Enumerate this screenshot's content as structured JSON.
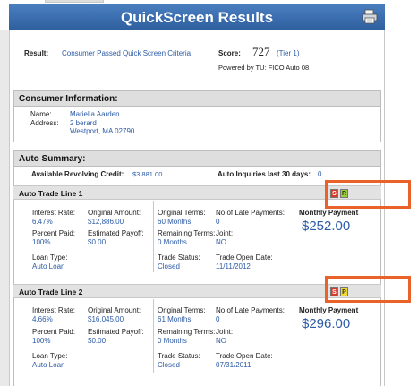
{
  "title": "QuickScreen Results",
  "result": {
    "label": "Result:",
    "value": "Consumer Passed Quick Screen Criteria"
  },
  "score": {
    "label": "Score:",
    "value": "727",
    "tier": "(Tier 1)",
    "powered_by": "Powered by TU: FICO Auto 08"
  },
  "consumer": {
    "header": "Consumer Information:",
    "name_label": "Name:",
    "name": "Mariella Aarden",
    "address_label": "Address:",
    "address_line1": "2 berard",
    "address_line2": "Westport, MA 02790"
  },
  "auto": {
    "header": "Auto Summary:",
    "revolving_label": "Available Revolving Credit:",
    "revolving_value": "$3,881.00",
    "inquiries_label": "Auto Inquiries last 30 days:",
    "inquiries_value": "0"
  },
  "labels": {
    "interest_rate": "Interest Rate:",
    "original_amount": "Original Amount:",
    "original_terms": "Original Terms:",
    "late_payments": "No of Late Payments:",
    "monthly_payment": "Monthly Payment",
    "percent_paid": "Percent Paid:",
    "estimated_payoff": "Estimated Payoff:",
    "remaining_terms": "Remaining Terms:",
    "joint": "Joint:",
    "loan_type": "Loan Type:",
    "trade_status": "Trade Status:",
    "trade_open_date": "Trade Open Date:"
  },
  "trades": [
    {
      "name": "Auto Trade Line 1",
      "badge1": "S",
      "badge2": "R",
      "interest_rate": "6.47%",
      "original_amount": "$12,886.00",
      "original_terms": "60 Months",
      "late_payments": "0",
      "monthly_payment": "$252.00",
      "percent_paid": "100%",
      "estimated_payoff": "$0.00",
      "remaining_terms": "0 Months",
      "joint": "NO",
      "loan_type": "Auto Loan",
      "trade_status": "Closed",
      "trade_open_date": "11/11/2012"
    },
    {
      "name": "Auto Trade Line 2",
      "badge1": "S",
      "badge2": "P",
      "interest_rate": "4.66%",
      "original_amount": "$16,045.00",
      "original_terms": "61 Months",
      "late_payments": "0",
      "monthly_payment": "$296.00",
      "percent_paid": "100%",
      "estimated_payoff": "$0.00",
      "remaining_terms": "0 Months",
      "joint": "NO",
      "loan_type": "Auto Loan",
      "trade_status": "Closed",
      "trade_open_date": "07/31/2011"
    }
  ],
  "colors": {
    "accent": "#2b5aa6",
    "header_blue": "#3a6db0",
    "highlight": "#e8622a"
  },
  "icons": {
    "print": "print-icon"
  }
}
